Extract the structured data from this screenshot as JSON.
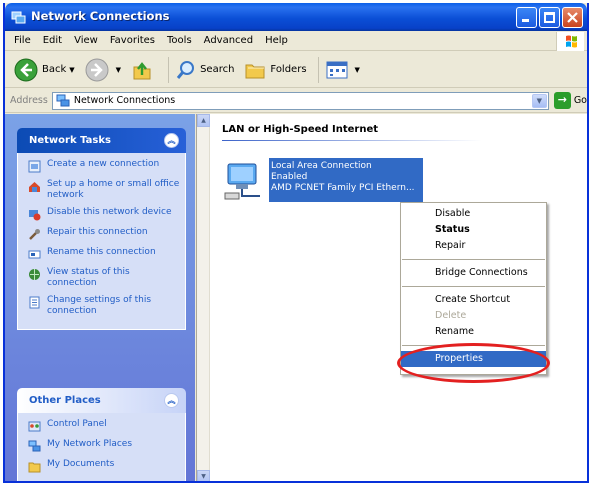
{
  "window": {
    "title": "Network Connections"
  },
  "menu": [
    "File",
    "Edit",
    "View",
    "Favorites",
    "Tools",
    "Advanced",
    "Help"
  ],
  "toolbar": {
    "back": "Back",
    "search": "Search",
    "folders": "Folders"
  },
  "address": {
    "label": "Address",
    "value": "Network Connections",
    "go": "Go"
  },
  "network_tasks": {
    "title": "Network Tasks",
    "items": [
      "Create a new connection",
      "Set up a home or small office network",
      "Disable this network device",
      "Repair this connection",
      "Rename this connection",
      "View status of this connection",
      "Change settings of this connection"
    ]
  },
  "other_places": {
    "title": "Other Places",
    "items": [
      "Control Panel",
      "My Network Places",
      "My Documents"
    ]
  },
  "group": {
    "title": "LAN or High-Speed Internet"
  },
  "connection": {
    "name": "Local Area Connection",
    "status": "Enabled",
    "device": "AMD PCNET Family PCI Ethern..."
  },
  "context_menu": {
    "items": [
      {
        "label": "Disable",
        "state": "normal"
      },
      {
        "label": "Status",
        "state": "bold"
      },
      {
        "label": "Repair",
        "state": "normal"
      },
      {
        "label": "Bridge Connections",
        "state": "normal"
      },
      {
        "label": "Create Shortcut",
        "state": "normal"
      },
      {
        "label": "Delete",
        "state": "disabled"
      },
      {
        "label": "Rename",
        "state": "normal"
      },
      {
        "label": "Properties",
        "state": "selected"
      }
    ]
  },
  "colors": {
    "xp_blue": "#0b4fd6",
    "selection": "#316ac5",
    "task_text": "#215dc6",
    "annotation_red": "#e32020"
  }
}
